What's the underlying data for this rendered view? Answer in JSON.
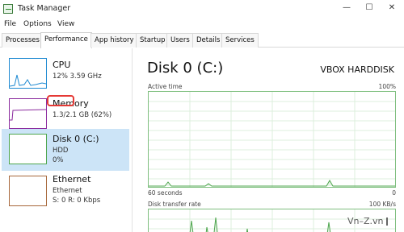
{
  "window": {
    "title": "Task Manager",
    "minimize": "—",
    "maximize": "☐",
    "close": "✕"
  },
  "menu": [
    "File",
    "Options",
    "View"
  ],
  "tabs": [
    {
      "label": "Processes",
      "active": false
    },
    {
      "label": "Performance",
      "active": true
    },
    {
      "label": "App history",
      "active": false
    },
    {
      "label": "Startup",
      "active": false
    },
    {
      "label": "Users",
      "active": false
    },
    {
      "label": "Details",
      "active": false
    },
    {
      "label": "Services",
      "active": false
    }
  ],
  "sidebar": {
    "cpu": {
      "title": "CPU",
      "sub": "12% 3.59 GHz"
    },
    "memory": {
      "title": "Memory",
      "sub": "1.3/2.1 GB (62%)"
    },
    "disk": {
      "title": "Disk 0 (C:)",
      "sub1": "HDD",
      "sub2": "0%"
    },
    "ethernet": {
      "title": "Ethernet",
      "sub1": "Ethernet",
      "sub2": "S: 0 R: 0 Kbps"
    }
  },
  "main": {
    "title": "Disk 0 (C:)",
    "device": "VBOX HARDDISK",
    "active_time_label": "Active time",
    "active_time_max": "100%",
    "seconds_label": "60 seconds",
    "zero_label": "0",
    "transfer_label": "Disk transfer rate",
    "transfer_max": "100 KB/s"
  },
  "watermark": "Vn–Z.vn",
  "colors": {
    "cpu": "#1f8ad2",
    "memory": "#8b2b9e",
    "disk": "#4da54d",
    "ethernet": "#a7673a",
    "selected": "#cce4f7",
    "highlight": "#e53935"
  }
}
